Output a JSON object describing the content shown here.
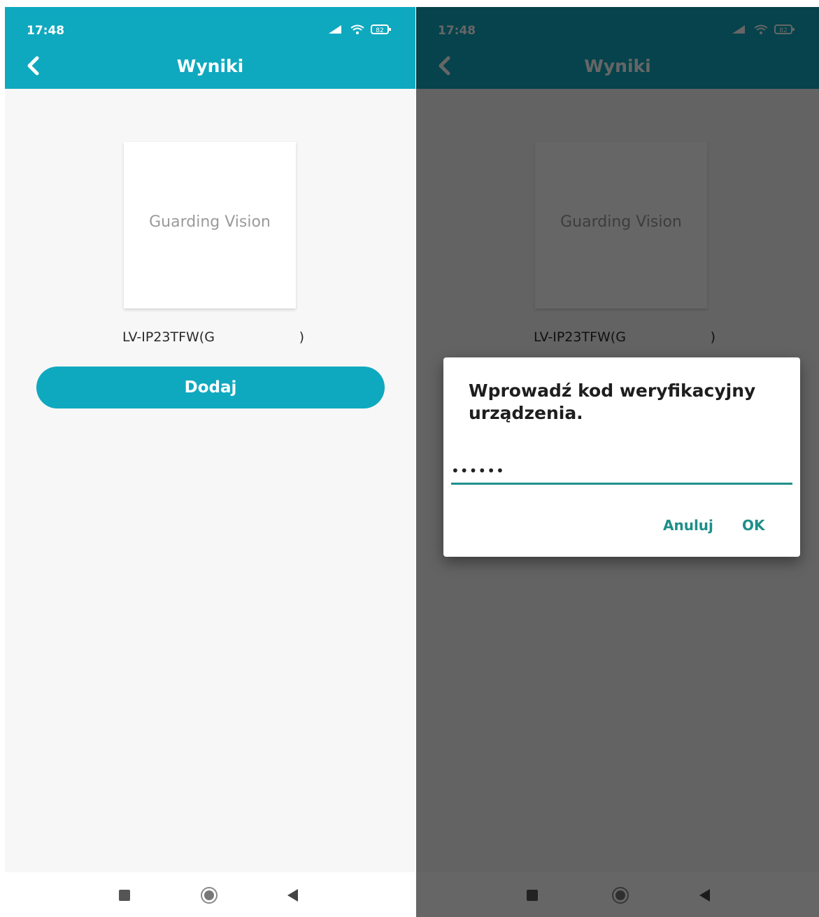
{
  "status_bar": {
    "time": "17:48",
    "battery": "82"
  },
  "app_bar": {
    "title": "Wyniki"
  },
  "device": {
    "logo_text": "Guarding Vision",
    "name": "LV-IP23TFW(G",
    "name_suffix": ")"
  },
  "add_button_label": "Dodaj",
  "dialog": {
    "title": "Wprowadź kod weryfikacyjny urządzenia.",
    "input_value": "••••••",
    "cancel_label": "Anuluj",
    "ok_label": "OK"
  },
  "colors": {
    "accent": "#0fa9bf",
    "dialog_accent": "#1e8f8a"
  }
}
